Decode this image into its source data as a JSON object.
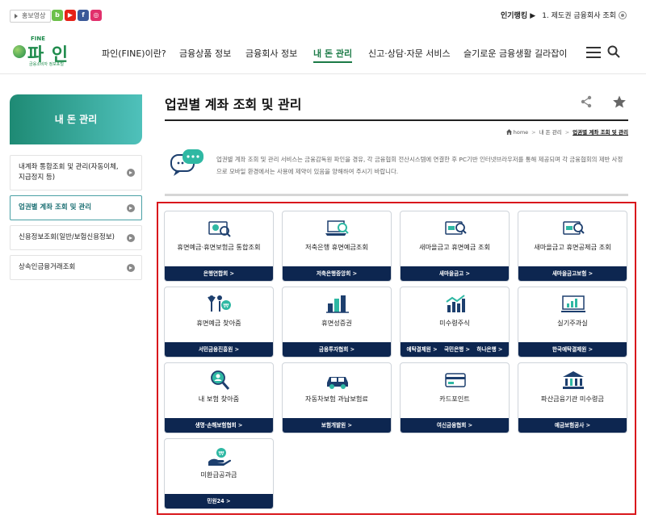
{
  "topbar": {
    "promo_label": "홍보영상",
    "sns": [
      {
        "name": "blog",
        "glyph": "b"
      },
      {
        "name": "youtube",
        "glyph": "▶"
      },
      {
        "name": "facebook",
        "glyph": "f"
      },
      {
        "name": "instagram",
        "glyph": "◎"
      }
    ],
    "ranking_label": "인기랭킹 ▶",
    "ranking_number": "1.",
    "ranking_text": "제도권 금융회사 조회"
  },
  "logo": {
    "top": "FINE",
    "text": "파 인",
    "sub": "금융소비자 정보포털"
  },
  "nav": {
    "items": [
      {
        "label": "파인(FINE)이란?"
      },
      {
        "label": "금융상품 정보"
      },
      {
        "label": "금융회사 정보"
      },
      {
        "label": "내 돈 관리"
      },
      {
        "label": "신고·상담·자문 서비스"
      },
      {
        "label": "슬기로운 금융생활 길라잡이"
      }
    ]
  },
  "sidebar": {
    "title": "내 돈 관리",
    "items": [
      {
        "label": "내계좌 통합조회 및 관리(자동이체, 지급정지 등)"
      },
      {
        "label": "업권별 계좌 조회 및 관리"
      },
      {
        "label": "신용정보조회(일반/보험신용정보)"
      },
      {
        "label": "상속인금융거래조회"
      }
    ]
  },
  "content": {
    "title": "업권별 계좌 조회 및 관리",
    "breadcrumb": [
      "home",
      "내 돈 관리",
      "업권별 계좌 조회 및 관리"
    ],
    "info": "업권별 계좌 조회 및 관리 서비스는 금융감독원 파인을 경유, 각 금융협회 전산시스템에 연결한 후 PC기반 인터넷브라우저를 통해 제공되며 각 금융협회의 제반 사정으로 모바일 환경에서는 사용에 제약이 있음을 양해하여 주시기 바랍니다."
  },
  "colors": {
    "accent": "#1b7a46",
    "footer": "#0d2650",
    "highlight": "#d9171c"
  },
  "cards": [
    {
      "icon": "bank-search-icon",
      "label": "휴면예금·휴면보험금 통합조회",
      "links": [
        "은행연합회 >"
      ]
    },
    {
      "icon": "laptop-search-icon",
      "label": "저축은행 휴면예금조회",
      "links": [
        "저축은행중앙회 >"
      ]
    },
    {
      "icon": "mg-search-icon",
      "label": "새마을금고 휴면예금 조회",
      "links": [
        "새마을금고 >"
      ]
    },
    {
      "icon": "mg-search-icon",
      "label": "새마을금고 휴면공제금 조회",
      "links": [
        "새마을금고보험 >"
      ]
    },
    {
      "icon": "people-coin-icon",
      "label": "휴면예금 찾아줌",
      "links": [
        "서민금융진흥원 >"
      ]
    },
    {
      "icon": "building-chart-icon",
      "label": "휴면성증권",
      "links": [
        "금융투자협회 >"
      ]
    },
    {
      "icon": "stock-chart-icon",
      "label": "미수령주식",
      "links": [
        "예탁결제원 >",
        "국민은행 >",
        "하나은행 >"
      ]
    },
    {
      "icon": "monitor-chart-icon",
      "label": "실기주과실",
      "links": [
        "한국예탁결제원 >"
      ]
    },
    {
      "icon": "magnifier-person-icon",
      "label": "내 보험 찾아줌",
      "links": [
        "생명·손해보험협회 >"
      ]
    },
    {
      "icon": "car-icon",
      "label": "자동차보험 과납보험료",
      "links": [
        "보험개발원 >"
      ]
    },
    {
      "icon": "card-icon",
      "label": "카드포인트",
      "links": [
        "여신금융협회 >"
      ]
    },
    {
      "icon": "bank-building-icon",
      "label": "파산금융기관 미수령금",
      "links": [
        "예금보험공사 >"
      ]
    },
    {
      "icon": "hand-coin-icon",
      "label": "미환급공과금",
      "links": [
        "민원24 >"
      ]
    }
  ]
}
